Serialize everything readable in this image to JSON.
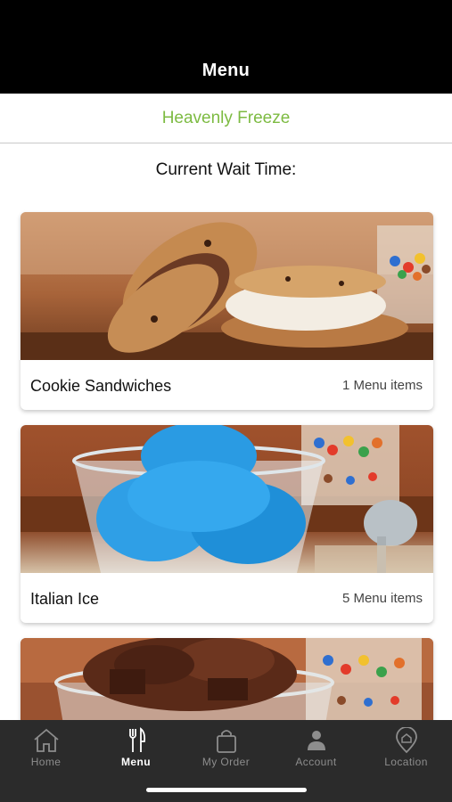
{
  "header": {
    "title": "Menu"
  },
  "store": {
    "name": "Heavenly Freeze"
  },
  "wait": {
    "label": "Current Wait Time:"
  },
  "categories": [
    {
      "name": "Cookie Sandwiches",
      "count": "1 Menu items",
      "image": "cookie-sandwich-photo"
    },
    {
      "name": "Italian Ice",
      "count": "5 Menu items",
      "image": "blue-italian-ice-photo"
    },
    {
      "name": "",
      "count": "",
      "image": "chocolate-ice-cream-photo"
    }
  ],
  "tabs": [
    {
      "label": "Home",
      "icon": "home-icon",
      "active": false
    },
    {
      "label": "Menu",
      "icon": "fork-knife-icon",
      "active": true
    },
    {
      "label": "My Order",
      "icon": "shopping-bag-icon",
      "active": false
    },
    {
      "label": "Account",
      "icon": "person-icon",
      "active": false
    },
    {
      "label": "Location",
      "icon": "location-pin-icon",
      "active": false
    }
  ],
  "colors": {
    "brand_green": "#7dbb42",
    "header_bg": "#000000",
    "tabbar_bg": "#2b2b2b"
  }
}
